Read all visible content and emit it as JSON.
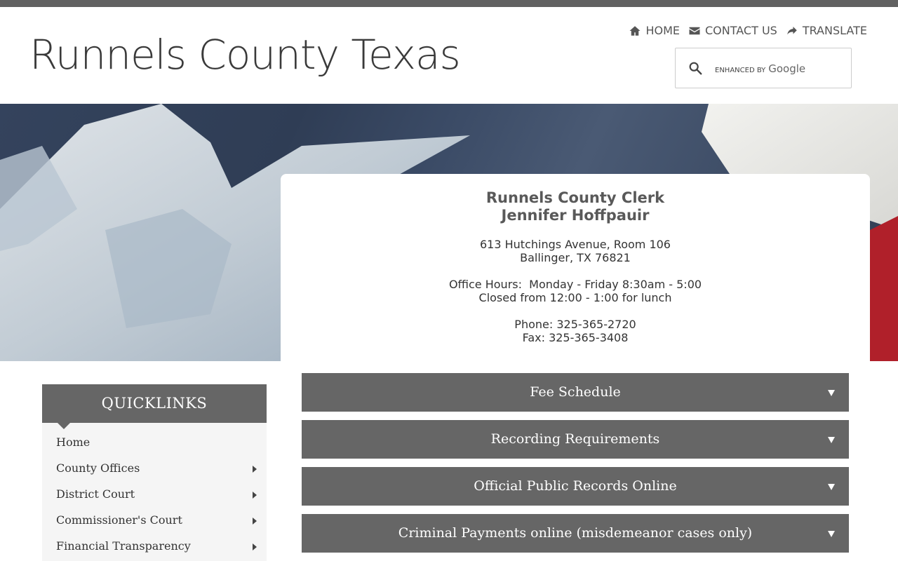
{
  "site": {
    "title": "Runnels County Texas"
  },
  "nav": {
    "home": "HOME",
    "contact": "CONTACT US",
    "translate": "TRANSLATE"
  },
  "search": {
    "enhanced_label": "ENHANCED BY",
    "brand": "Google",
    "placeholder": ""
  },
  "card": {
    "title_line1": "Runnels County Clerk",
    "title_line2": "Jennifer Hoffpauir",
    "address_line1": "613 Hutchings Avenue, Room 106",
    "address_line2": "Ballinger, TX 76821",
    "hours_line1": "Office Hours:  Monday - Friday 8:30am - 5:00",
    "hours_line2": "Closed from 12:00 - 1:00 for lunch",
    "phone": "Phone: 325-365-2720",
    "fax": "Fax: 325-365-3408"
  },
  "quicklinks": {
    "heading": "QUICKLINKS",
    "items": [
      {
        "label": "Home"
      },
      {
        "label": "County Offices"
      },
      {
        "label": "District Court"
      },
      {
        "label": "Commissioner's Court"
      },
      {
        "label": "Financial Transparency"
      }
    ]
  },
  "accordion": {
    "items": [
      {
        "label": "Fee Schedule"
      },
      {
        "label": "Recording Requirements"
      },
      {
        "label": "Official Public Records Online"
      },
      {
        "label": "Criminal Payments online (misdemeanor cases only)"
      }
    ]
  },
  "colors": {
    "topbar": "#616161",
    "panel": "#666666",
    "flag_red": "#b0202a",
    "flag_blue": "#34435d"
  }
}
